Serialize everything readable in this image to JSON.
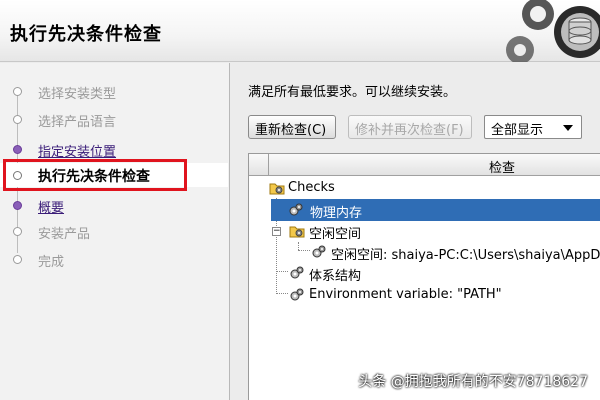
{
  "header": {
    "title": "执行先决条件检查"
  },
  "steps": [
    {
      "label": "选择安装类型",
      "state": "pending"
    },
    {
      "label": "选择产品语言",
      "state": "pending"
    },
    {
      "label": "指定安装位置",
      "state": "link"
    },
    {
      "label": "执行先决条件检查",
      "state": "current"
    },
    {
      "label": "概要",
      "state": "link"
    },
    {
      "label": "安装产品",
      "state": "pending"
    },
    {
      "label": "完成",
      "state": "pending"
    }
  ],
  "main": {
    "status_message": "满足所有最低要求。可以继续安装。",
    "buttons": {
      "recheck": "重新检查(C)",
      "fix_recheck": "修补并再次检查(F)",
      "show_all": "全部显示"
    },
    "table": {
      "column_header": "检查",
      "rows": [
        {
          "text": "Checks",
          "icon": "folder-gear-icon"
        },
        {
          "text": "物理内存",
          "icon": "gear-icon",
          "selected": true
        },
        {
          "text": "空闲空间",
          "icon": "folder-gear-icon"
        },
        {
          "text": "空闲空间: shaiya-PC:C:\\Users\\shaiya\\AppD",
          "icon": "gear-icon"
        },
        {
          "text": "体系结构",
          "icon": "gear-icon"
        },
        {
          "text": "Environment variable: \"PATH\"",
          "icon": "gear-icon"
        }
      ]
    }
  },
  "watermark": "头条 @拥抱我所有的不安78718627",
  "colors": {
    "accent_selected": "#2f6db5",
    "link": "#3a1c78",
    "highlight_box": "#e0141e"
  }
}
